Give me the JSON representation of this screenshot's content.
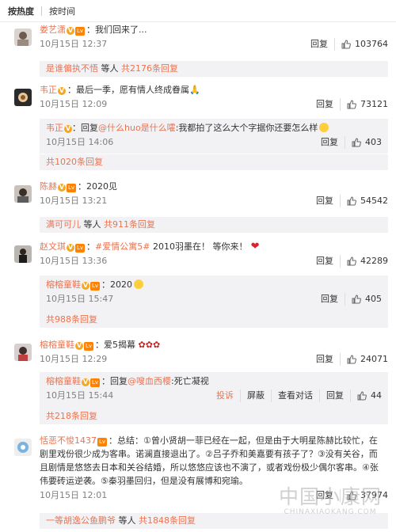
{
  "sort": {
    "hot": "按热度",
    "time": "按时间"
  },
  "labels": {
    "reply": "回复",
    "report": "投诉",
    "block": "屏蔽",
    "view": "查看对话"
  },
  "comments": [
    {
      "user": "娄艺潇",
      "lv": "Lv",
      "text": "：我们回来了...",
      "time": "10月15日 12:37",
      "likes": "103764",
      "more": {
        "who": "是谁偏执不悟",
        "rest": " 等人 ",
        "count": "共2176条回复"
      }
    },
    {
      "user": "韦正",
      "text": "：最后一季，愿有情人终成眷属🙏",
      "time": "10月15日 12:09",
      "likes": "73121",
      "reply": {
        "user": "韦正",
        "prefix": "：回复",
        "target": "@什么huo是什么嚯",
        "text": ":我都拍了这么大个字据你还要怎么样",
        "time": "10月15日 14:06",
        "likes": "403"
      },
      "more": {
        "count": "共1020条回复"
      }
    },
    {
      "user": "陈赫",
      "lv": "Lv",
      "text": "：2020见",
      "time": "10月15日 13:21",
      "likes": "54542",
      "more": {
        "who": "满可可儿",
        "rest": " 等人 ",
        "count": "共911条回复"
      }
    },
    {
      "user": "赵文琪",
      "lv": "Lv",
      "tag": "#爱情公寓5#",
      "text": " 2010羽墨在！ 等你来！",
      "time": "10月15日 13:36",
      "likes": "42289",
      "reply": {
        "user": "榕榕童鞋",
        "lv": "Lv",
        "prefix": "：",
        "text": "2020",
        "time": "10月15日 15:47",
        "likes": "405"
      },
      "more": {
        "count": "共988条回复"
      }
    },
    {
      "user": "榕榕童鞋",
      "lv": "Lv",
      "text": "：爱5揭幕",
      "time": "10月15日 12:29",
      "likes": "24071",
      "reply": {
        "user": "榕榕童鞋",
        "lv": "Lv",
        "prefix": "：回复",
        "target": "@嗖血西樱",
        "text": ":死亡凝视",
        "time": "10月15日 15:44",
        "likes": "44"
      },
      "more": {
        "count": "共218条回复"
      }
    },
    {
      "user": "恬恶不悛1437",
      "lv": "Lv",
      "text": "：总结：①曾小贤胡一菲已经在一起，但是由于大明星陈赫比较忙，在剧里戏份很少成为客串。诺澜直接退出了。②吕子乔和美嘉要有孩子了？③没有关谷，而且剧情是悠悠去日本和关谷结婚，所以悠悠应该也不演了，或者戏份极少偶尔客串。④张伟要砖运逆袭。⑤秦羽墨回归，但是没有展博和宛瑜。",
      "time": "10月15日 12:01",
      "likes": "37974",
      "more": {
        "who": "一等胡逸公鱼鹏爷",
        "rest": " 等人 ",
        "count": "共1848条回复"
      }
    }
  ],
  "watermark": {
    "big": "中国小康网",
    "small": "CHINAXIAOKANG.COM"
  },
  "colors": {
    "link": "#eb7350",
    "sub_bg": "#f2f2f5"
  }
}
